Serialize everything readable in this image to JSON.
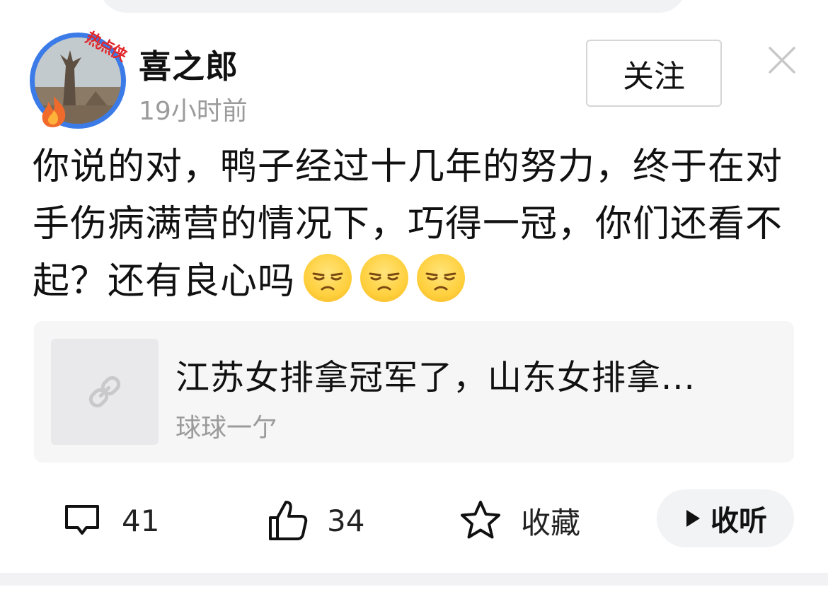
{
  "header": {
    "avatar_badge": "热点侠",
    "username": "喜之郎",
    "time": "19小时前",
    "follow_label": "关注"
  },
  "post": {
    "text": "你说的对，鸭子经过十几年的努力，终于在对手伤病满营的情况下，巧得一冠，你们还看不起？还有良心吗",
    "emoji_count": 3
  },
  "link_card": {
    "title": "江苏女排拿冠军了，山东女排拿...",
    "source": "球球一亇"
  },
  "actions": {
    "comments": "41",
    "likes": "34",
    "favorite_label": "收藏",
    "listen_label": "收听"
  },
  "colors": {
    "avatar_ring": "#3b7be8",
    "badge_red": "#e2262a",
    "muted_text": "#9b9b9b",
    "card_bg": "#f6f6f7"
  }
}
